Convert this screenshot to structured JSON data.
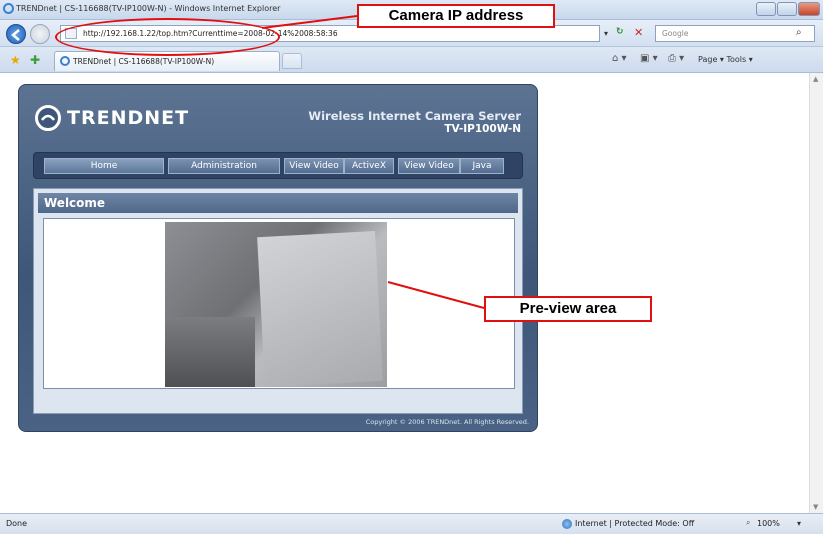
{
  "window": {
    "title": "TRENDnet | CS-116688(TV-IP100W-N) - Windows Internet Explorer"
  },
  "navbar": {
    "url": "http://192.168.1.22/top.htm?Currenttime=2008-02-14%2008:58:36",
    "search_placeholder": "Google"
  },
  "tabbar": {
    "tab_label": "TRENDnet | CS-116688(TV-IP100W-N)",
    "command_bar": "Page ▾  Tools ▾"
  },
  "page": {
    "logo": "TRENDNET",
    "product_title": "Wireless Internet Camera Server",
    "product_model": "TV-IP100W-N",
    "menu": [
      {
        "label": "Home"
      },
      {
        "label": "Administration"
      },
      {
        "label": "View Video"
      },
      {
        "label": "ActiveX"
      },
      {
        "label": "View Video"
      },
      {
        "label": "Java"
      }
    ],
    "welcome": "Welcome",
    "copyright": "Copyright © 2006 TRENDnet. All Rights Reserved."
  },
  "annotations": {
    "camera_ip": "Camera IP address",
    "preview": "Pre-view area"
  },
  "statusbar": {
    "status": "Done",
    "zone": "Internet | Protected Mode: Off",
    "zoom": "100%"
  },
  "colors": {
    "annotation": "#e01010",
    "panel": "#3e5778"
  }
}
